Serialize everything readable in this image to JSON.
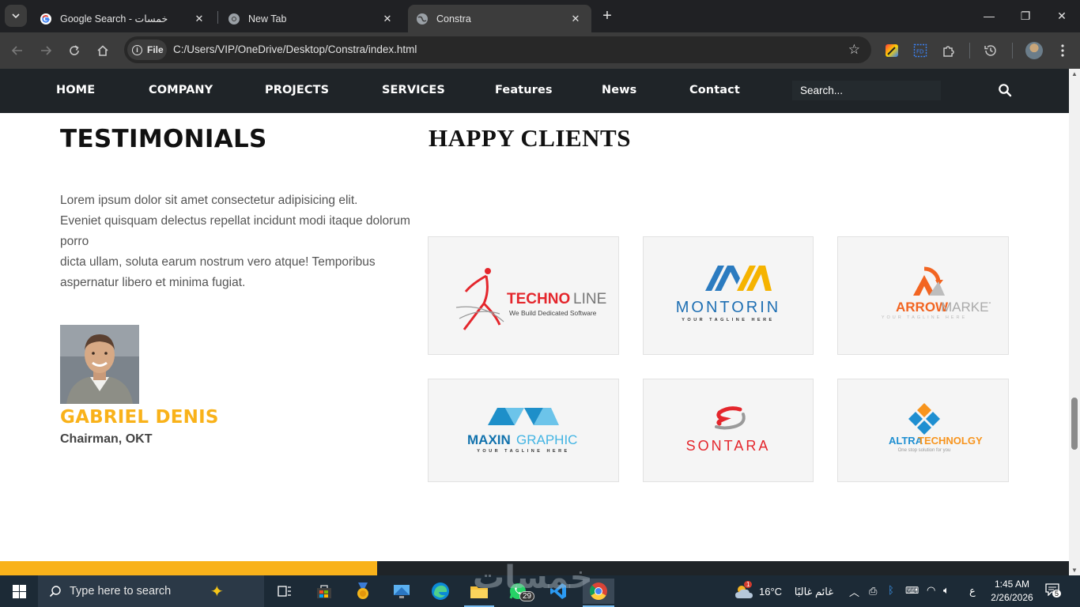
{
  "browser": {
    "tabs": [
      {
        "title": "Google Search - خمسات",
        "icon": "google-icon",
        "active": false
      },
      {
        "title": "New Tab",
        "icon": "chrome-icon",
        "active": false
      },
      {
        "title": "Constra",
        "icon": "globe-icon",
        "active": true
      }
    ],
    "address_chip": "File",
    "url": "C:/Users/VIP/OneDrive/Desktop/Constra/index.html"
  },
  "site_nav": {
    "items": [
      "HOME",
      "COMPANY",
      "PROJECTS",
      "SERVICES",
      "Features",
      "News",
      "Contact"
    ],
    "search_placeholder": "Search..."
  },
  "testimonials": {
    "heading": "TESTIMONIALS",
    "quote_lines": [
      "Lorem ipsum dolor sit amet consectetur adipisicing elit.",
      "Eveniet quisquam delectus repellat incidunt modi itaque dolorum porro",
      "dicta ullam, soluta earum nostrum vero atque! Temporibus aspernatur libero et minima fugiat."
    ],
    "name": "GABRIEL DENIS",
    "role": "Chairman, OKT"
  },
  "clients": {
    "heading": "HAPPY CLIENTS",
    "logos": [
      {
        "name_a": "TECHNO",
        "name_b": " LINE",
        "tagline": "We Build Dedicated Software"
      },
      {
        "name_a": "MONTORIN",
        "tagline": "YOUR TAGLINE HERE"
      },
      {
        "name_a": "ARROW",
        "name_b": "MARKET",
        "tagline": "YOUR TAGLINE HERE"
      },
      {
        "name_a": "MAXIN",
        "name_b": "GRAPHIC",
        "tagline": "YOUR TAGLINE HERE"
      },
      {
        "name_a": "SONTARA"
      },
      {
        "name_a": "ALTRA",
        "name_b": " TECHNOLGY",
        "tagline": "One stop solution for you"
      }
    ]
  },
  "taskbar": {
    "search_placeholder": "Type here to search",
    "whatsapp_badge": "29",
    "weather_temp": "16°C",
    "weather_desc": "غائم غالبًا",
    "weather_badge": "1",
    "lang": "ع",
    "time": "1:45 AM",
    "date": "2/26/2026",
    "notification_count": "5",
    "watermark": "خمسات"
  },
  "colors": {
    "accent_yellow": "#f9b21a",
    "nav_dark": "#1f2428"
  }
}
